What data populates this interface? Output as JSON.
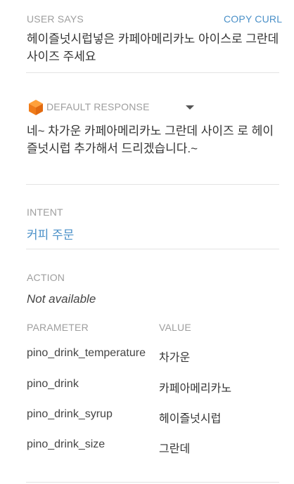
{
  "user_says": {
    "label": "USER SAYS",
    "copy_curl": "COPY CURL",
    "text": "헤이즐넛시럽넣은 카페아메리카노 아이스로 그란데사이즈 주세요"
  },
  "default_response": {
    "label": "DEFAULT RESPONSE",
    "icon": "cube-icon",
    "accent": "#f5821f",
    "text": "네~ 차가운 카페아메리카노 그란데 사이즈 로 헤이즐넛시럽 추가해서 드리겠습니다.~"
  },
  "intent": {
    "label": "INTENT",
    "value": "커피 주문",
    "color": "#4a90c8"
  },
  "action": {
    "label": "ACTION",
    "value": "Not available"
  },
  "parameters": {
    "header_param": "PARAMETER",
    "header_value": "VALUE",
    "rows": [
      {
        "name": "pino_drink_temperature",
        "value": "차가운"
      },
      {
        "name": "pino_drink",
        "value": "카페아메리카노"
      },
      {
        "name": "pino_drink_syrup",
        "value": "헤이즐넛시럽"
      },
      {
        "name": "pino_drink_size",
        "value": "그란데"
      }
    ]
  }
}
